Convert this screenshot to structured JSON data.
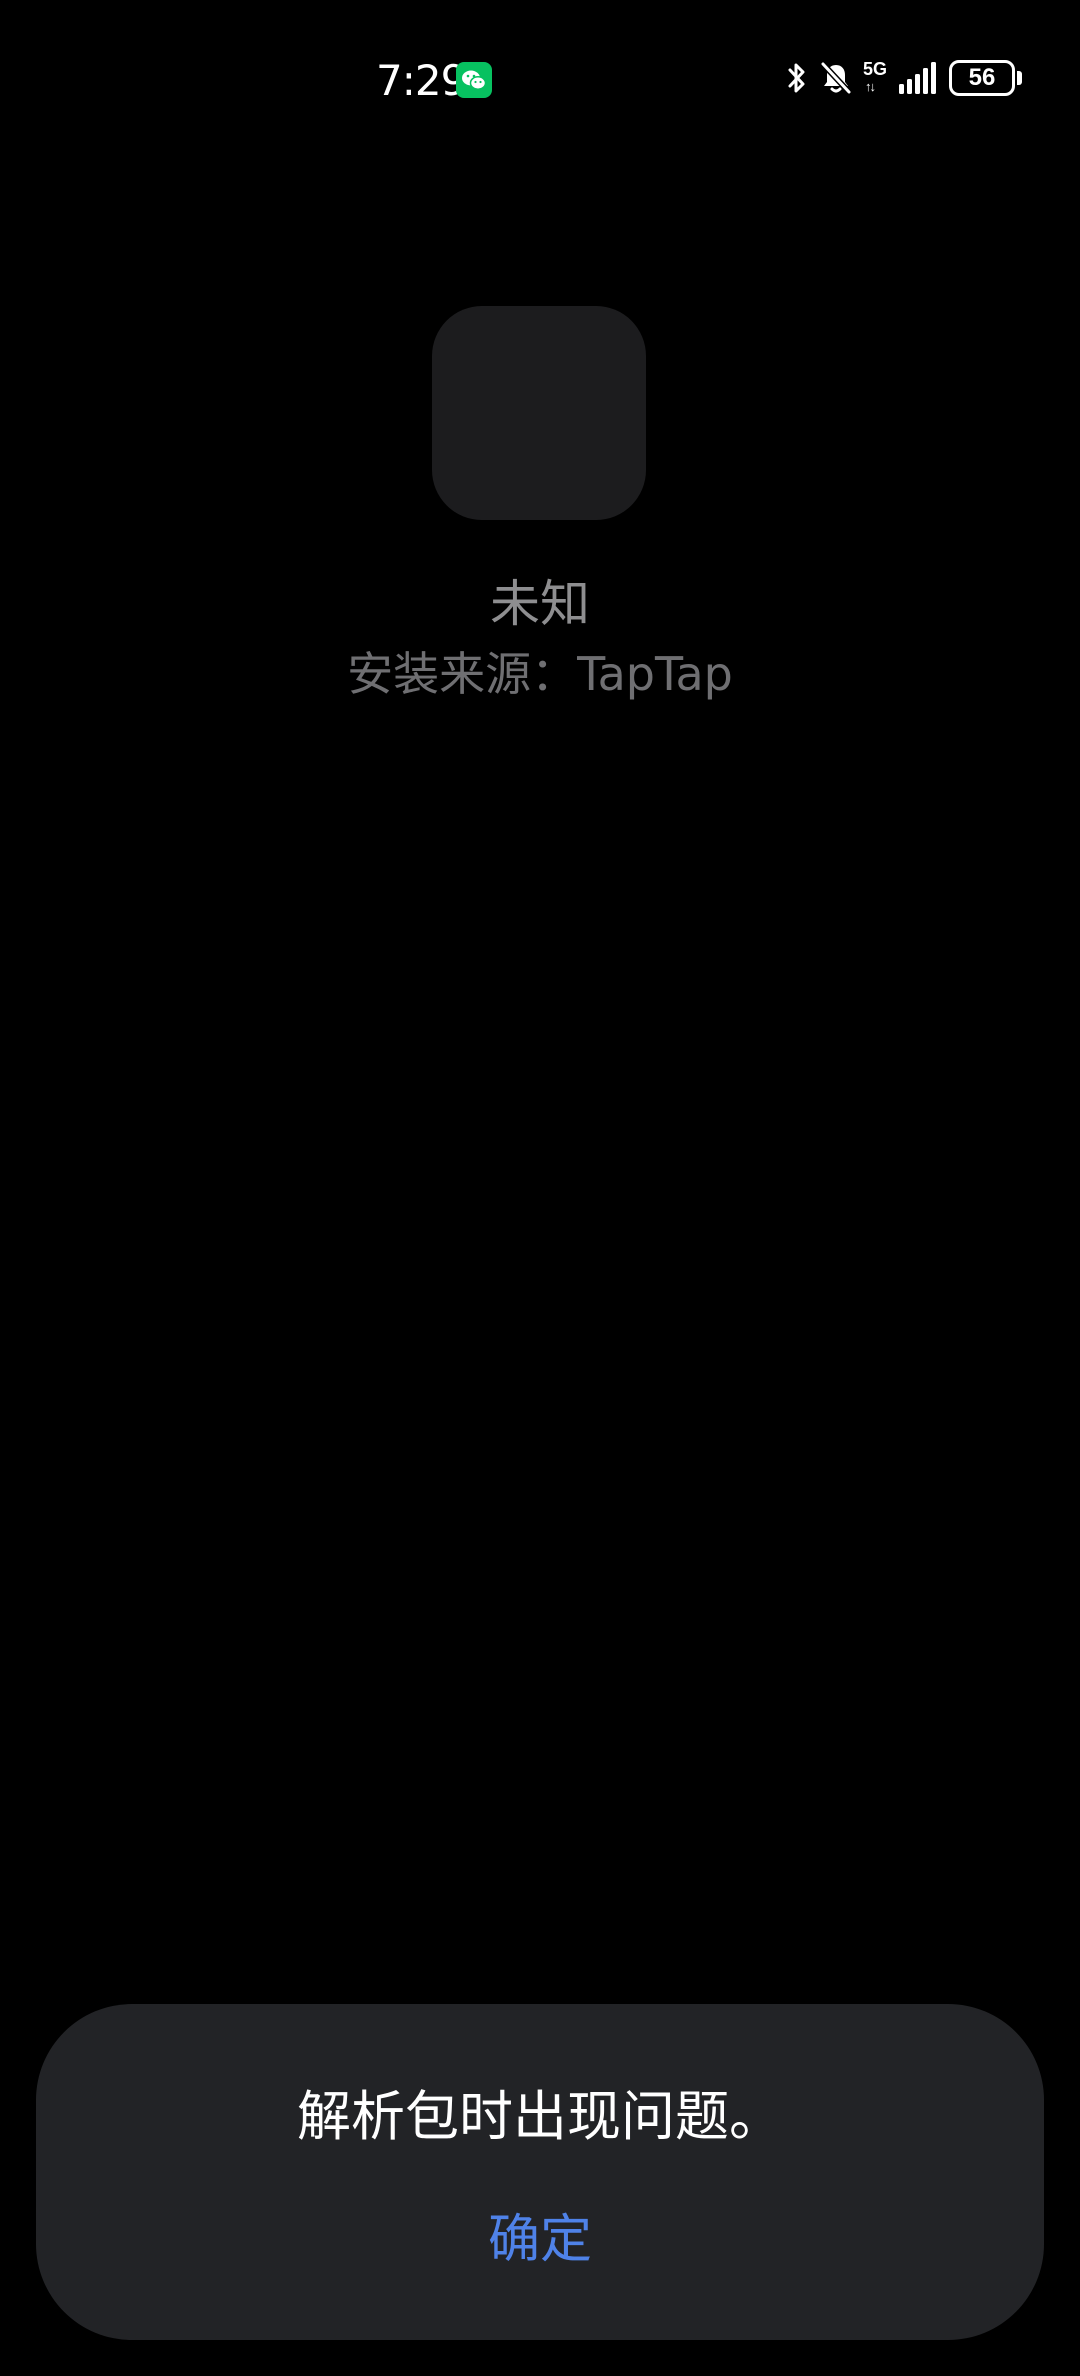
{
  "status_bar": {
    "time": "7:29",
    "network": "5G",
    "network_arrows": "↑↓",
    "battery_level": "56",
    "icons": {
      "notification_app": "wechat-icon",
      "bluetooth": "bluetooth-icon",
      "silent": "bell-off-icon",
      "signal": "signal-icon",
      "battery": "battery-icon"
    }
  },
  "app": {
    "name": "未知",
    "install_source": "安装来源：TapTap"
  },
  "dialog": {
    "message": "解析包时出现问题。",
    "confirm_label": "确定"
  },
  "colors": {
    "background": "#000000",
    "dialog_background": "#222326",
    "accent": "#4f82e8",
    "wechat_green": "#07c160",
    "muted_text": "#8e8e90"
  }
}
